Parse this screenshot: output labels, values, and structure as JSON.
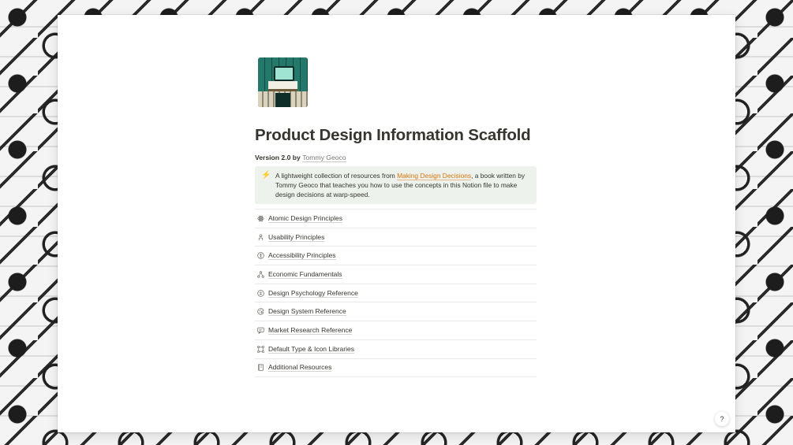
{
  "page": {
    "title": "Product Design Information Scaffold",
    "version_label": "Version 2.0 by ",
    "author": "Tommy Geoco",
    "icon": "library-illustration"
  },
  "callout": {
    "icon": "lightning-icon",
    "text_before": "A lightweight collection of resources from ",
    "link_text": "Making Design Decisions",
    "text_after": ", a book written by Tommy Geoco that teaches you how to use the concepts in this Notion file to make design decisions at warp-speed."
  },
  "items": [
    {
      "label": "Atomic Design Principles",
      "icon": "atom-icon"
    },
    {
      "label": "Usability Principles",
      "icon": "person-icon"
    },
    {
      "label": "Accessibility Principles",
      "icon": "accessibility-icon"
    },
    {
      "label": "Economic Fundamentals",
      "icon": "network-icon"
    },
    {
      "label": "Design Psychology Reference",
      "icon": "brain-icon"
    },
    {
      "label": "Design System Reference",
      "icon": "palette-icon"
    },
    {
      "label": "Market Research Reference",
      "icon": "chat-icon"
    },
    {
      "label": "Default Type & Icon Libraries",
      "icon": "frame-icon"
    },
    {
      "label": "Additional Resources",
      "icon": "book-icon"
    }
  ],
  "help": {
    "label": "?"
  },
  "colors": {
    "accent_link": "#d9730d",
    "callout_bg": "#edf3ec",
    "text": "#37352f"
  }
}
